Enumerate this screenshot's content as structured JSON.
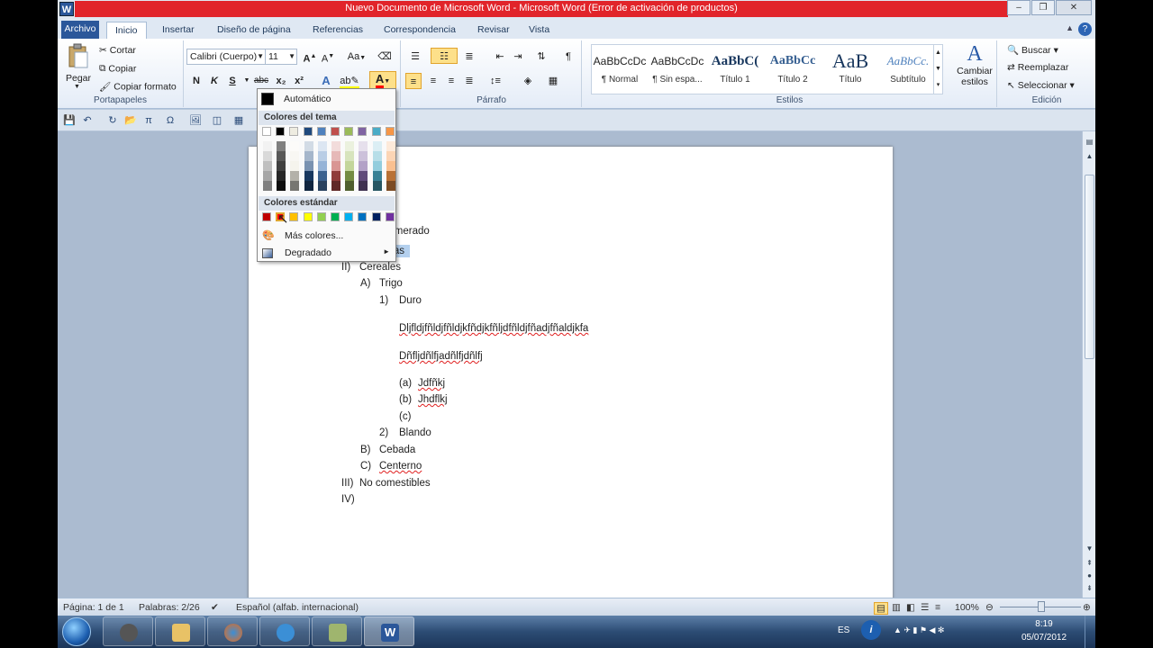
{
  "window": {
    "title": "Nuevo Documento de Microsoft Word  -  Microsoft Word (Error de activación de productos)",
    "app_icon": "W"
  },
  "tabs": {
    "file": "Archivo",
    "items": [
      "Inicio",
      "Insertar",
      "Diseño de página",
      "Referencias",
      "Correspondencia",
      "Revisar",
      "Vista"
    ],
    "active": "Inicio"
  },
  "clipboard": {
    "paste": "Pegar",
    "cut": "Cortar",
    "copy": "Copiar",
    "format": "Copiar formato",
    "group": "Portapapeles"
  },
  "font": {
    "name": "Calibri (Cuerpo)",
    "size": "11",
    "case": "Aa",
    "bold": "N",
    "italic": "K",
    "underline": "S",
    "strike": "abc",
    "sub": "x₂",
    "sup": "x²",
    "font_color_letter": "A"
  },
  "paragraph": {
    "group": "Párrafo",
    "pilcrow": "¶"
  },
  "styles": {
    "group": "Estilos",
    "items": [
      {
        "sample": "AaBbCcDc",
        "name": "¶ Normal"
      },
      {
        "sample": "AaBbCcDc",
        "name": "¶ Sin espa..."
      },
      {
        "sample": "AaBbC(",
        "name": "Título 1"
      },
      {
        "sample": "AaBbCc",
        "name": "Título 2"
      },
      {
        "sample": "AaB",
        "name": "Título"
      },
      {
        "sample": "AaBbCc.",
        "name": "Subtítulo"
      }
    ],
    "change": "Cambiar",
    "change2": "estilos"
  },
  "editing": {
    "group": "Edición",
    "find": "Buscar",
    "replace": "Reemplazar",
    "select": "Seleccionar"
  },
  "color_panel": {
    "automatic": "Automático",
    "theme_header": "Colores del tema",
    "standard_header": "Colores estándar",
    "more": "Más colores...",
    "gradient": "Degradado",
    "theme_colors": [
      "#ffffff",
      "#000000",
      "#eeece1",
      "#1f497d",
      "#4f81bd",
      "#c0504d",
      "#9bbb59",
      "#8064a2",
      "#4bacc6",
      "#f79646"
    ],
    "standard_colors": [
      "#c00000",
      "#ff0000",
      "#ffc000",
      "#ffff00",
      "#92d050",
      "#00b050",
      "#00b0f0",
      "#0070c0",
      "#002060",
      "#7030a0"
    ]
  },
  "document": {
    "title_line": "numerado",
    "lines": [
      {
        "num": "I)",
        "text": "Verduras",
        "level": 0,
        "highlight": true
      },
      {
        "num": "II)",
        "text": "Cereales",
        "level": 0
      },
      {
        "num": "A)",
        "text": "Trigo",
        "level": 1
      },
      {
        "num": "1)",
        "text": "Duro",
        "level": 2
      },
      {
        "num": "",
        "text": "Dljfldjfñldjfñldjkfñdjkfñljdfñldjfñadjfñaldjkfa",
        "level": 2,
        "squiggle": true,
        "para": true
      },
      {
        "num": "",
        "text": "Dñfljdñlfjadñlfjdñlfj",
        "level": 2,
        "squiggle": true,
        "para": true
      },
      {
        "num": "(a)",
        "text": "Jdfñkj",
        "level": 3,
        "squiggle": true
      },
      {
        "num": "(b)",
        "text": "Jhdflkj",
        "level": 3,
        "squiggle": true
      },
      {
        "num": "(c)",
        "text": "",
        "level": 3
      },
      {
        "num": "2)",
        "text": "Blando",
        "level": 2
      },
      {
        "num": "B)",
        "text": "Cebada",
        "level": 1
      },
      {
        "num": "C)",
        "text": "Centerno",
        "level": 1,
        "squiggle": true
      },
      {
        "num": "III)",
        "text": "No comestibles",
        "level": 0
      },
      {
        "num": "IV)",
        "text": "",
        "level": 0
      }
    ]
  },
  "status": {
    "page": "Página: 1 de 1",
    "words": "Palabras: 2/26",
    "language": "Español (alfab. internacional)",
    "zoom": "100%"
  },
  "taskbar": {
    "lang": "ES",
    "time": "8:19",
    "date": "05/07/2012"
  }
}
